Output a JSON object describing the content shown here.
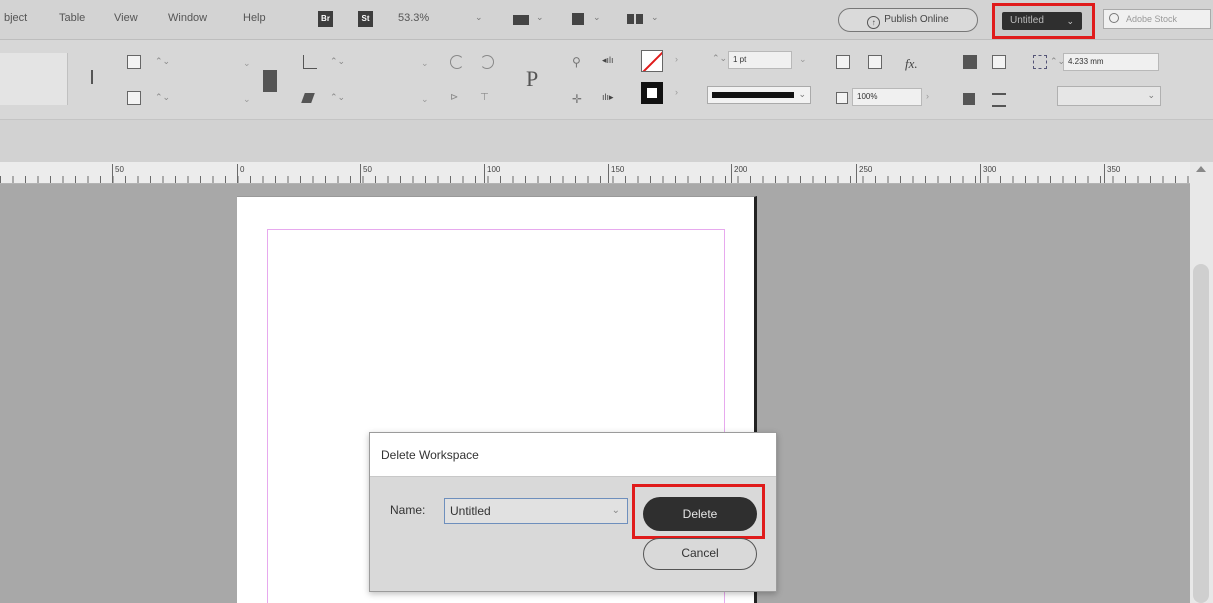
{
  "menubar": {
    "items": [
      "bject",
      "Table",
      "View",
      "Window",
      "Help"
    ],
    "app_icons": [
      "Br",
      "St"
    ],
    "zoom": "53.3%",
    "publish_label": "Publish Online",
    "workspace": "Untitled",
    "stock_placeholder": "Adobe Stock"
  },
  "controlbar": {
    "stroke_weight": "1 pt",
    "opacity": "100%",
    "dimension": "4.233 mm"
  },
  "ruler": {
    "labels": [
      "50",
      "0",
      "50",
      "100",
      "150",
      "200",
      "250",
      "300",
      "350"
    ]
  },
  "dialog": {
    "title": "Delete Workspace",
    "name_label": "Name:",
    "name_value": "Untitled",
    "delete_label": "Delete",
    "cancel_label": "Cancel"
  },
  "colors": {
    "highlight": "#e01b1b",
    "margin_guide": "#e7a9ee",
    "delete_button": "#2f2f2f"
  }
}
